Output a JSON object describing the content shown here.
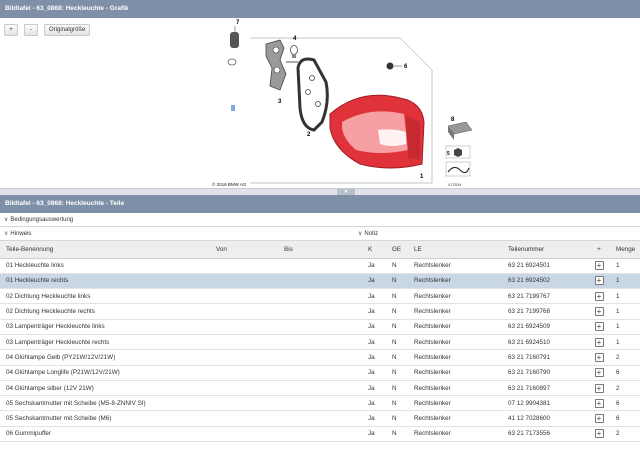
{
  "graphic_panel": {
    "title": "Bildtafel - 63_0868: Heckleuchte - Grafik",
    "zoom_in_label": "+",
    "zoom_out_label": "-",
    "original_size_label": "Originalgröße",
    "copyright": "© 2016 BMW AG",
    "figure_number": "472534",
    "callouts": [
      "7",
      "4",
      "6",
      "3",
      "2",
      "1",
      "8",
      "5"
    ],
    "collapse_icon": "chevron-down-icon"
  },
  "parts_panel": {
    "title": "Bildtafel - 63_0868: Heckleuchte - Teile",
    "condition_label": "Bedingungsauswertung",
    "hint_label": "Hinweis",
    "note_label": "Notiz",
    "columns": [
      "Teile-Benennung",
      "Von",
      "Bis",
      "K",
      "GE",
      "LE",
      "Teilenummer",
      "+",
      "Menge"
    ],
    "rows": [
      {
        "name": "01 Heckleuchte links",
        "von": "",
        "bis": "",
        "k": "Ja",
        "ge": "N",
        "le": "Rechtslenker",
        "part": "63 21 6924501",
        "qty": "1"
      },
      {
        "name": "01 Heckleuchte rechts",
        "von": "",
        "bis": "",
        "k": "Ja",
        "ge": "N",
        "le": "Rechtslenker",
        "part": "63 21 6924502",
        "qty": "1"
      },
      {
        "name": "02 Dichtung Heckleuchte links",
        "von": "",
        "bis": "",
        "k": "Ja",
        "ge": "N",
        "le": "Rechtslenker",
        "part": "63 21 7199767",
        "qty": "1"
      },
      {
        "name": "02 Dichtung Heckleuchte rechts",
        "von": "",
        "bis": "",
        "k": "Ja",
        "ge": "N",
        "le": "Rechtslenker",
        "part": "63 21 7199768",
        "qty": "1"
      },
      {
        "name": "03 Lampenträger Heckleuchte links",
        "von": "",
        "bis": "",
        "k": "Ja",
        "ge": "N",
        "le": "Rechtslenker",
        "part": "63 21 6924509",
        "qty": "1"
      },
      {
        "name": "03 Lampenträger Heckleuchte rechts",
        "von": "",
        "bis": "",
        "k": "Ja",
        "ge": "N",
        "le": "Rechtslenker",
        "part": "63 21 6924510",
        "qty": "1"
      },
      {
        "name": "04 Glühlampe Gelb (PY21W/12V/21W)",
        "von": "",
        "bis": "",
        "k": "Ja",
        "ge": "N",
        "le": "Rechtslenker",
        "part": "63 21 7160791",
        "qty": "2"
      },
      {
        "name": "04 Glühlampe Longlife (P21W/12V/21W)",
        "von": "",
        "bis": "",
        "k": "Ja",
        "ge": "N",
        "le": "Rechtslenker",
        "part": "63 21 7160790",
        "qty": "6"
      },
      {
        "name": "04 Glühlampe silber (12V 21W)",
        "von": "",
        "bis": "",
        "k": "Ja",
        "ge": "N",
        "le": "Rechtslenker",
        "part": "63 21 7160897",
        "qty": "2"
      },
      {
        "name": "05 Sechskantmutter mit Scheibe (M5-8-ZNNIV SI)",
        "von": "",
        "bis": "",
        "k": "Ja",
        "ge": "N",
        "le": "Rechtslenker",
        "part": "07 12 9904381",
        "qty": "6"
      },
      {
        "name": "05 Sechskantmutter mit Scheibe (M6)",
        "von": "",
        "bis": "",
        "k": "Ja",
        "ge": "N",
        "le": "Rechtslenker",
        "part": "41 12 7028600",
        "qty": "6"
      },
      {
        "name": "06 Gummipuffer",
        "von": "",
        "bis": "",
        "k": "Ja",
        "ge": "N",
        "le": "Rechtslenker",
        "part": "63 21 7173556",
        "qty": "2"
      }
    ],
    "selected_row": 1,
    "add_icon": "plus-box-icon"
  },
  "colors": {
    "header_bg": "#7e8fa8",
    "selected_row_bg": "#c9d6e6",
    "lamp_red": "#e0323a"
  }
}
